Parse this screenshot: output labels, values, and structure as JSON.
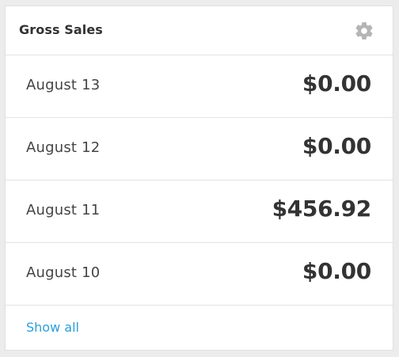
{
  "widget": {
    "title": "Gross Sales",
    "settings_icon": "gear-icon",
    "rows": [
      {
        "date": "August 13",
        "amount": "$0.00"
      },
      {
        "date": "August 12",
        "amount": "$0.00"
      },
      {
        "date": "August 11",
        "amount": "$456.92"
      },
      {
        "date": "August 10",
        "amount": "$0.00"
      }
    ],
    "show_all_label": "Show all"
  },
  "colors": {
    "background": "#ececec",
    "card": "#ffffff",
    "text": "#333333",
    "icon": "#b5b5b5",
    "link": "#2aa0d8",
    "divider": "#e3e3e3"
  }
}
